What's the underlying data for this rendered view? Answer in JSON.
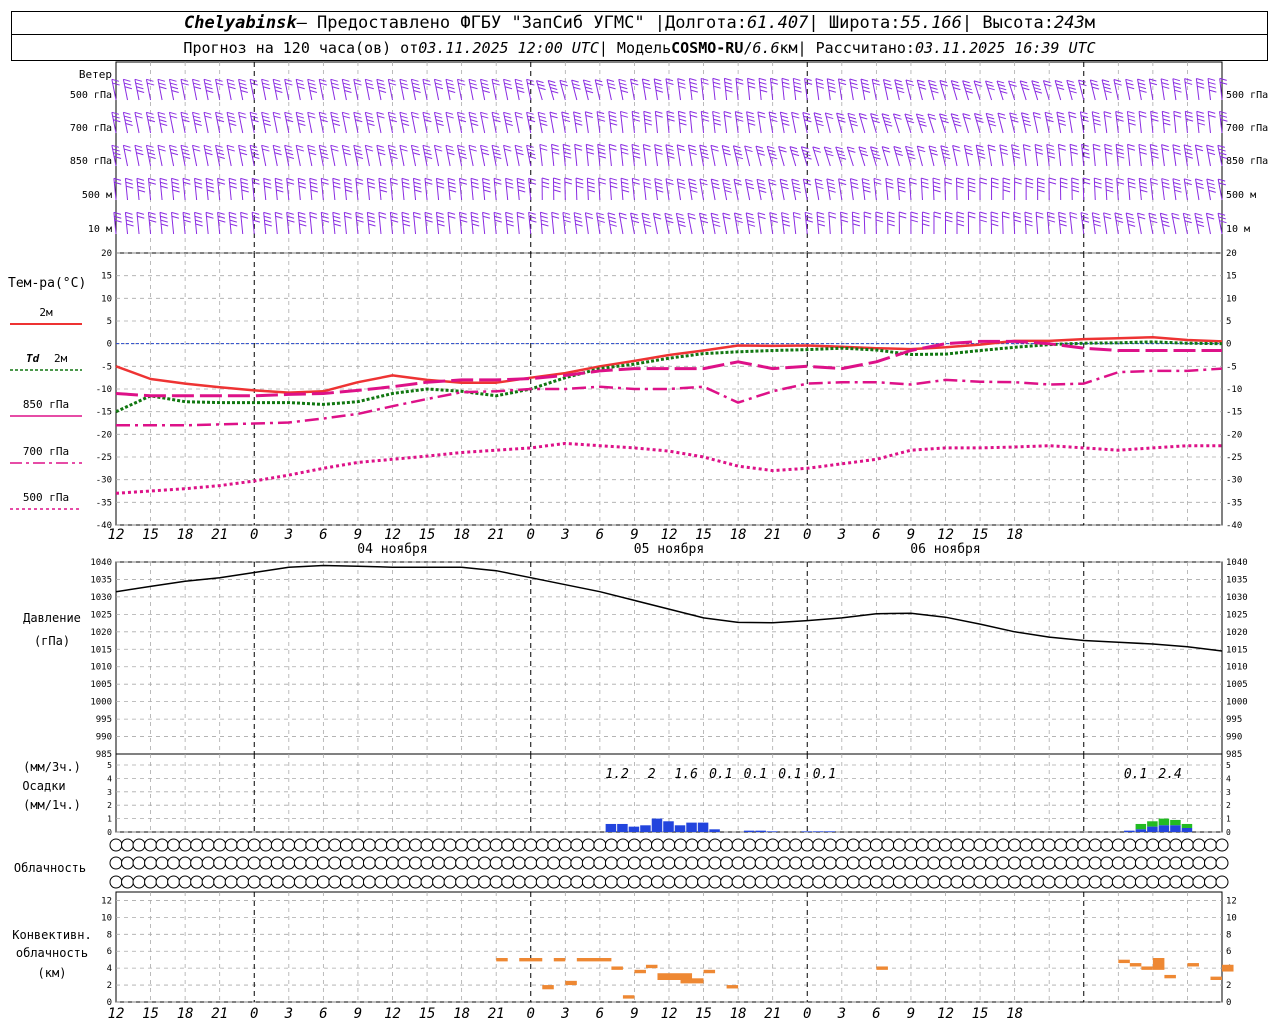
{
  "header": {
    "station": "Chelyabinsk",
    "provider": " — Предоставлено ФГБУ \"ЗапСиб УГМС\" | ",
    "lon_label": "Долгота: ",
    "lon": "61.407",
    "lat_label": " | Широта: ",
    "lat": "55.166",
    "alt_label": " | Высота: ",
    "alt": "243",
    "alt_unit": "м",
    "forecast_prefix": "Прогноз на 120 часа(ов) от ",
    "forecast_time": "03.11.2025 12:00 UTC",
    "model_label": "  | Модель ",
    "model": "COSMO-RU",
    "model_sep": " / ",
    "model_res": "6.6",
    "model_res_unit": "км",
    "calc_label": " | Рассчитано: ",
    "calc_time": "03.11.2025 16:39 UTC"
  },
  "colors": {
    "wind": "#8a2be2",
    "t2m": "#ee3333",
    "td2m": "#117711",
    "t850": "#dd1188",
    "t700": "#dd1188",
    "t500": "#dd1188",
    "zero_line": "#2244cc",
    "pressure": "#000000",
    "precip_rain": "#2244dd",
    "precip_mix": "#22bb22",
    "convective": "#ee8833",
    "grid": "#aaaaaa"
  },
  "time_axis": {
    "hour_labels": [
      "12",
      "15",
      "18",
      "21",
      "0",
      "3",
      "6",
      "9",
      "12",
      "15",
      "18",
      "21",
      "0",
      "3",
      "6",
      "9",
      "12",
      "15",
      "18",
      "21",
      "0",
      "3",
      "6",
      "9",
      "12",
      "15",
      "18"
    ],
    "day_labels": [
      "04 ноября",
      "05 ноября",
      "06 ноября"
    ],
    "day_label_hours": [
      27,
      51,
      75
    ]
  },
  "wind_panel": {
    "label": "Ветер",
    "levels_left": [
      "500 гПа",
      "700 гПа",
      "850 гПа",
      "500 м",
      "10  м"
    ],
    "levels_right": [
      "500 гПа",
      "700 гПа",
      "850 гПа",
      "500 м",
      "10  м"
    ]
  },
  "temp_panel": {
    "title": "Тем-ра(°C)",
    "legend": {
      "t2m": {
        "label": "2м"
      },
      "td2m": {
        "prefix": "Td",
        "label": "2м"
      },
      "t850": {
        "label": "850 гПа"
      },
      "t700": {
        "label": "700 гПа"
      },
      "t500": {
        "label": "500 гПа"
      }
    },
    "yticks": [
      "20",
      "15",
      "10",
      "5",
      "0",
      "-5",
      "-10",
      "-15",
      "-20",
      "-25",
      "-30",
      "-35",
      "-40"
    ]
  },
  "pressure_panel": {
    "label_line1": "Давление",
    "label_line2": "(гПа)",
    "yticks": [
      "1040",
      "1035",
      "1030",
      "1025",
      "1020",
      "1015",
      "1010",
      "1005",
      "1000",
      "995",
      "990",
      "985"
    ]
  },
  "precip_panel": {
    "label_line1": "(мм/3ч.)",
    "label_line2": "Осадки",
    "label_line3": "(мм/1ч.)",
    "yticks": [
      "5",
      "4",
      "3",
      "2",
      "1",
      "0"
    ],
    "amounts": [
      {
        "text": "1.2",
        "hour": 43.5
      },
      {
        "text": "2",
        "hour": 46.5
      },
      {
        "text": "1.6",
        "hour": 49.5
      },
      {
        "text": "0.1",
        "hour": 52.5
      },
      {
        "text": "0.1",
        "hour": 55.5
      },
      {
        "text": "0.1",
        "hour": 58.5
      },
      {
        "text": "0.1",
        "hour": 61.5
      },
      {
        "text": "0.1",
        "hour": 88.5
      },
      {
        "text": "2.4",
        "hour": 91.5
      }
    ]
  },
  "cloud_panel": {
    "label": "Облачность"
  },
  "conv_panel": {
    "label_line1": "Конвективн.",
    "label_line2": "облачность",
    "label_line3": "(км)",
    "yticks": [
      "12",
      "10",
      "8",
      "6",
      "4",
      "2",
      "0"
    ]
  },
  "chart_data": {
    "type": "line",
    "hours_from_start": [
      0,
      3,
      6,
      9,
      12,
      15,
      18,
      21,
      24,
      27,
      30,
      33,
      36,
      39,
      42,
      45,
      48,
      51,
      54,
      57,
      60,
      63,
      66,
      69,
      72,
      75,
      78,
      81,
      84,
      87,
      90,
      93,
      96
    ],
    "series": [
      {
        "name": "2м",
        "key": "t2m",
        "values": [
          -5,
          -7.8,
          -8.8,
          -9.6,
          -10.3,
          -10.8,
          -10.5,
          -8.5,
          -7,
          -8,
          -8.6,
          -8.6,
          -7.5,
          -6.5,
          -5,
          -3.8,
          -2.5,
          -1.5,
          -0.4,
          -0.5,
          -0.4,
          -0.7,
          -1,
          -1.2,
          -0.8,
          -0.2,
          0.6,
          0.6,
          1,
          1.2,
          1.4,
          0.8,
          0.5
        ]
      },
      {
        "name": "Td 2м",
        "key": "td2m",
        "values": [
          -15,
          -11.5,
          -12.8,
          -13,
          -13,
          -13,
          -13.4,
          -12.8,
          -11,
          -10,
          -10.5,
          -11.5,
          -10,
          -7.5,
          -5.5,
          -4.5,
          -3.2,
          -2.2,
          -1.8,
          -1.5,
          -1.3,
          -1,
          -1.4,
          -2.4,
          -2.3,
          -1.5,
          -0.8,
          -0.2,
          0.1,
          0.2,
          0.4,
          0.1,
          0
        ]
      },
      {
        "name": "850 гПа",
        "key": "t850",
        "values": [
          -11,
          -11.5,
          -11.5,
          -11.5,
          -11.5,
          -11.2,
          -11,
          -10.3,
          -9.5,
          -8.5,
          -8,
          -8,
          -7.7,
          -7,
          -6,
          -5.5,
          -5.5,
          -5.5,
          -4,
          -5.5,
          -5,
          -5.5,
          -4,
          -1.5,
          0,
          0.5,
          0.5,
          0,
          -1,
          -1.5,
          -1.5,
          -1.5,
          -1.5
        ]
      },
      {
        "name": "700 гПа",
        "key": "t700",
        "values": [
          -18,
          -18,
          -18,
          -17.8,
          -17.6,
          -17.4,
          -16.5,
          -15.5,
          -13.8,
          -12.2,
          -10.7,
          -10.5,
          -10,
          -10,
          -9.5,
          -10,
          -10,
          -9.5,
          -13,
          -10.5,
          -8.8,
          -8.5,
          -8.5,
          -9,
          -8,
          -8.4,
          -8.5,
          -9,
          -8.8,
          -6.3,
          -6,
          -6,
          -5.5
        ]
      },
      {
        "name": "500 гПа",
        "key": "t500",
        "values": [
          -33,
          -32.5,
          -32,
          -31.3,
          -30.3,
          -29,
          -27.5,
          -26.2,
          -25.5,
          -24.8,
          -24,
          -23.5,
          -23,
          -22,
          -22.5,
          -23,
          -23.7,
          -25,
          -27,
          -28,
          -27.5,
          -26.5,
          -25.5,
          -23.5,
          -23,
          -23,
          -22.8,
          -22.5,
          -23,
          -23.5,
          -23,
          -22.5,
          -22.5
        ]
      }
    ],
    "pressure": {
      "name": "Давление",
      "values": [
        1031.5,
        1033,
        1034.5,
        1035.5,
        1037,
        1038.5,
        1039,
        1038.8,
        1038.5,
        1038.5,
        1038.5,
        1037.5,
        1035.5,
        1033.5,
        1031.5,
        1029,
        1026.5,
        1024,
        1022.7,
        1022.6,
        1023.2,
        1024,
        1025.2,
        1025.3,
        1024.2,
        1022.2,
        1020,
        1018.5,
        1017.5,
        1017,
        1016.5,
        1015.7,
        1014.5
      ]
    },
    "precip": {
      "name": "Осадки",
      "hours": [
        43,
        44,
        45,
        46,
        47,
        48,
        49,
        50,
        51,
        52,
        55,
        56,
        57,
        60,
        61,
        62,
        88,
        89,
        90,
        91,
        92,
        93
      ],
      "values": [
        0.6,
        0.6,
        0.4,
        0.5,
        1,
        0.8,
        0.5,
        0.7,
        0.7,
        0.2,
        0.1,
        0.1,
        0.05,
        0.05,
        0.05,
        0.05,
        0.1,
        0.2,
        0.4,
        0.5,
        0.5,
        0.3
      ],
      "mix": [
        0,
        0,
        0,
        0,
        0,
        0,
        0,
        0,
        0,
        0,
        0,
        0,
        0,
        0,
        0,
        0,
        0,
        0.4,
        0.4,
        0.5,
        0.4,
        0.3
      ]
    },
    "cloud_cover": {
      "name": "Облачность",
      "step_hours": 1,
      "high": [
        0,
        0,
        0,
        0,
        0,
        0,
        0,
        0,
        0,
        0,
        0,
        0,
        0,
        0,
        0,
        0,
        0,
        0,
        0,
        0,
        0,
        0,
        0,
        0,
        0,
        0,
        0,
        0,
        0,
        0,
        0,
        0,
        0,
        0,
        0,
        0,
        0,
        0,
        0,
        0,
        0,
        0,
        0,
        0,
        0,
        0,
        0,
        0,
        0,
        0,
        0,
        0,
        0,
        0,
        0,
        0,
        0,
        0,
        0,
        0,
        0,
        0,
        0,
        0,
        0,
        0,
        0,
        0,
        0,
        0,
        0,
        0,
        0,
        0,
        0,
        0,
        0,
        0,
        0,
        0,
        0,
        0,
        0,
        0,
        0,
        0,
        0,
        0,
        0,
        0,
        0,
        0,
        0,
        0,
        0,
        0,
        0
      ],
      "mid": [
        0,
        0,
        0,
        0,
        0,
        0,
        0,
        0,
        0,
        0,
        0,
        0,
        0,
        0,
        0,
        0,
        0,
        0,
        0,
        0,
        0,
        0,
        0,
        0,
        0,
        0,
        0,
        0,
        0,
        0,
        0,
        0,
        0,
        0,
        0,
        0,
        0,
        0,
        0,
        0,
        0,
        0,
        0,
        0,
        0,
        0,
        0,
        0,
        0,
        0,
        0,
        0,
        0,
        0,
        0,
        0,
        0,
        0,
        0,
        0,
        0,
        0,
        0,
        0,
        0,
        0,
        0,
        0,
        0,
        0,
        0,
        0,
        0,
        0,
        0,
        0,
        0,
        0,
        0,
        0,
        0,
        0,
        0,
        0,
        0,
        0,
        0,
        0,
        0,
        0,
        0,
        0,
        0,
        0,
        0,
        0,
        0
      ],
      "low": [
        0,
        0,
        0,
        0,
        0,
        0,
        0,
        0,
        0,
        0,
        0,
        0,
        0,
        0,
        0,
        0,
        0,
        0,
        0,
        0,
        0,
        0,
        0,
        0,
        0,
        0,
        0,
        0,
        0,
        0,
        0,
        0,
        0,
        0,
        0,
        0,
        0,
        0,
        0,
        0,
        0,
        0,
        0,
        0,
        0,
        0,
        0,
        0,
        0,
        0,
        0,
        0,
        0,
        0,
        0,
        0,
        0,
        0,
        0,
        0,
        0,
        0,
        0,
        0,
        0,
        0,
        0,
        0,
        0,
        0,
        0,
        0,
        0,
        0,
        0,
        0,
        0,
        0,
        0,
        0,
        0,
        0,
        0,
        0,
        0,
        0,
        0,
        0,
        0,
        0,
        0,
        0,
        0,
        0,
        0,
        0,
        0
      ]
    },
    "convective": {
      "name": "Конвективн. облачность",
      "segments": [
        {
          "h0": 33,
          "h1": 34,
          "base": 4.8,
          "top": 5.2
        },
        {
          "h0": 35,
          "h1": 37,
          "base": 4.8,
          "top": 5.2
        },
        {
          "h0": 37,
          "h1": 38,
          "base": 1.5,
          "top": 2
        },
        {
          "h0": 38,
          "h1": 39,
          "base": 4.8,
          "top": 5.2
        },
        {
          "h0": 39,
          "h1": 40,
          "base": 2,
          "top": 2.5
        },
        {
          "h0": 40,
          "h1": 43,
          "base": 4.8,
          "top": 5.2
        },
        {
          "h0": 43,
          "h1": 44,
          "base": 3.8,
          "top": 4.2
        },
        {
          "h0": 44,
          "h1": 45,
          "base": 0.4,
          "top": 0.8
        },
        {
          "h0": 45,
          "h1": 46,
          "base": 3.4,
          "top": 3.8
        },
        {
          "h0": 46,
          "h1": 47,
          "base": 4,
          "top": 4.4
        },
        {
          "h0": 47,
          "h1": 50,
          "base": 2.6,
          "top": 3.4
        },
        {
          "h0": 49,
          "h1": 51,
          "base": 2.2,
          "top": 2.8
        },
        {
          "h0": 51,
          "h1": 52,
          "base": 3.4,
          "top": 3.8
        },
        {
          "h0": 53,
          "h1": 54,
          "base": 1.6,
          "top": 2
        },
        {
          "h0": 66,
          "h1": 67,
          "base": 3.8,
          "top": 4.2
        },
        {
          "h0": 87,
          "h1": 88,
          "base": 4.6,
          "top": 5
        },
        {
          "h0": 88,
          "h1": 89,
          "base": 4.2,
          "top": 4.6
        },
        {
          "h0": 89,
          "h1": 90,
          "base": 3.8,
          "top": 4.2
        },
        {
          "h0": 90,
          "h1": 91,
          "base": 3.8,
          "top": 5.2
        },
        {
          "h0": 91,
          "h1": 92,
          "base": 2.8,
          "top": 3.2
        },
        {
          "h0": 93,
          "h1": 94,
          "base": 4.2,
          "top": 4.6
        },
        {
          "h0": 95,
          "h1": 96,
          "base": 2.6,
          "top": 3
        },
        {
          "h0": 96,
          "h1": 97,
          "base": 3.6,
          "top": 4.4
        }
      ]
    },
    "ylim_temp": [
      -40,
      20
    ],
    "ylim_pressure": [
      985,
      1040
    ],
    "ylim_precip": [
      0,
      5
    ],
    "ylim_conv": [
      0,
      13
    ],
    "grid": true
  }
}
